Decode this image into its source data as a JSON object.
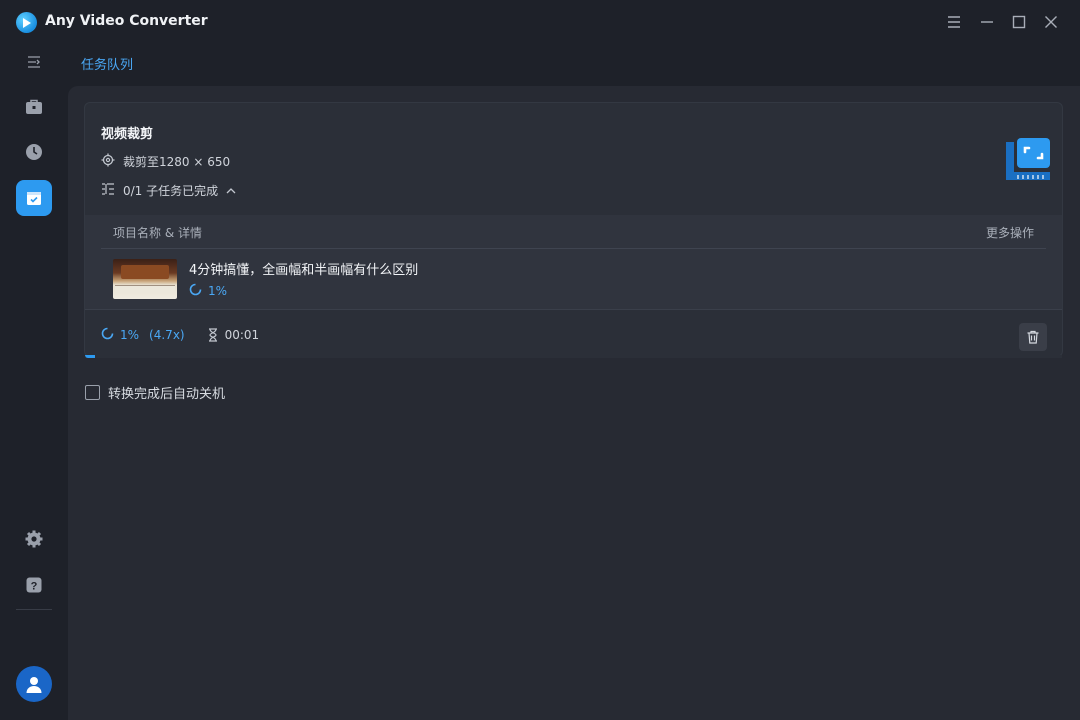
{
  "app": {
    "title": "Any Video Converter"
  },
  "header": {
    "tab_label": "任务队列"
  },
  "task": {
    "title": "视频裁剪",
    "crop_info": "裁剪至1280 × 650",
    "subtasks_status": "0/1 子任务已完成",
    "table": {
      "col_name": "项目名称 & 详情",
      "col_more": "更多操作"
    },
    "item": {
      "title": "4分钟搞懂，全画幅和半画幅有什么区别",
      "progress": "1%"
    },
    "summary": {
      "progress": "1%",
      "speed": "(4.7x)",
      "elapsed": "00:01"
    },
    "progress_fraction": 0.01
  },
  "options": {
    "auto_shutdown_label": "转换完成后自动关机",
    "auto_shutdown_checked": false
  },
  "colors": {
    "accent": "#2d9af0",
    "background": "#1e2129",
    "panel": "#272a33"
  },
  "icons": {
    "sidebar": [
      "collapse-icon",
      "toolbox-icon",
      "history-icon",
      "task-queue-icon",
      "settings-icon",
      "help-icon",
      "user-avatar-icon"
    ],
    "window": [
      "menu-icon",
      "minimize-icon",
      "maximize-icon",
      "close-icon"
    ]
  }
}
